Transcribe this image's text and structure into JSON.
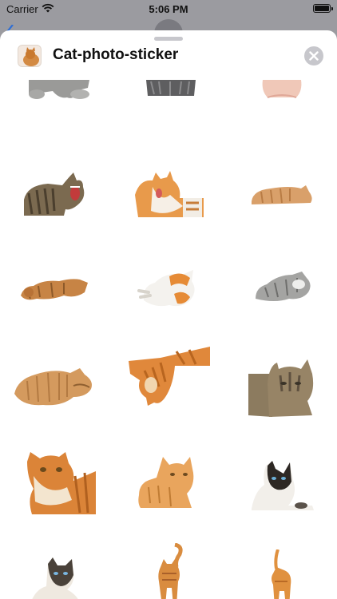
{
  "status_bar": {
    "carrier": "Carrier",
    "time": "5:06 PM"
  },
  "header": {
    "title": "Cat-photo-sticker"
  },
  "icons": {
    "wifi": "wifi-icon",
    "battery": "battery-icon",
    "close": "close-icon",
    "app": "cat-app-icon"
  },
  "colors": {
    "sheet_bg": "#ffffff",
    "dim_bg": "#9b9ba0",
    "close_bg": "#c7c7cc",
    "orange_cat": "#d9873a",
    "tabby_cat": "#8a7a60",
    "grey_cat": "#9a9a98"
  },
  "stickers": [
    {
      "name": "grey-cat-paws-partial"
    },
    {
      "name": "dark-grey-cat-partial"
    },
    {
      "name": "pink-cat-partial"
    },
    {
      "name": "tabby-cat-yawning"
    },
    {
      "name": "orange-white-cat-grooming"
    },
    {
      "name": "orange-cat-sleeping"
    },
    {
      "name": "orange-cat-lying-stretch"
    },
    {
      "name": "white-orange-cat-playing"
    },
    {
      "name": "grey-cat-rolling"
    },
    {
      "name": "orange-cat-lying"
    },
    {
      "name": "orange-cat-hanging"
    },
    {
      "name": "tabby-cat-peeking"
    },
    {
      "name": "orange-cat-portrait"
    },
    {
      "name": "orange-cat-crouching"
    },
    {
      "name": "siamese-cat-peeking"
    },
    {
      "name": "siamese-cat-sitting"
    },
    {
      "name": "orange-cat-walking-tail-up"
    },
    {
      "name": "orange-cat-walking-small"
    }
  ]
}
